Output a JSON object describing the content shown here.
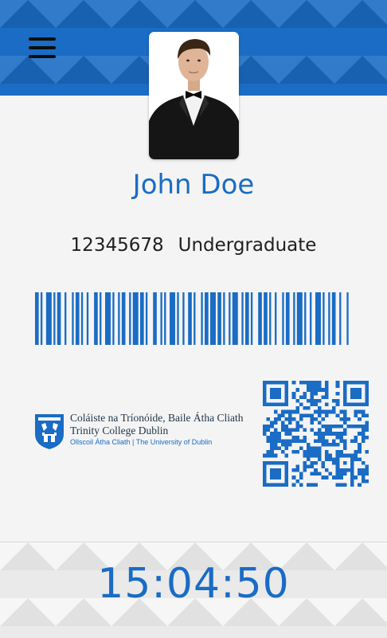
{
  "header": {
    "menu_icon": "hamburger-menu-icon"
  },
  "profile": {
    "photo_icon": "student-photo",
    "name": "John Doe",
    "student_number": "12345678",
    "student_type": "Undergraduate"
  },
  "barcode": {
    "icon": "barcode",
    "color": "#1a6cc4"
  },
  "institution": {
    "crest_icon": "college-crest-icon",
    "line1": "Coláiste na Tríonóide, Baile Átha Cliath",
    "line2": "Trinity College Dublin",
    "line3": "Ollscoil Átha Cliath | The University of Dublin"
  },
  "qr_code": {
    "icon": "qr-code",
    "color": "#1a6cc4"
  },
  "footer": {
    "time": "15:04:50"
  },
  "colors": {
    "brand_blue": "#1a6cc4",
    "background": "#f4f4f4",
    "text_dark": "#202020"
  }
}
